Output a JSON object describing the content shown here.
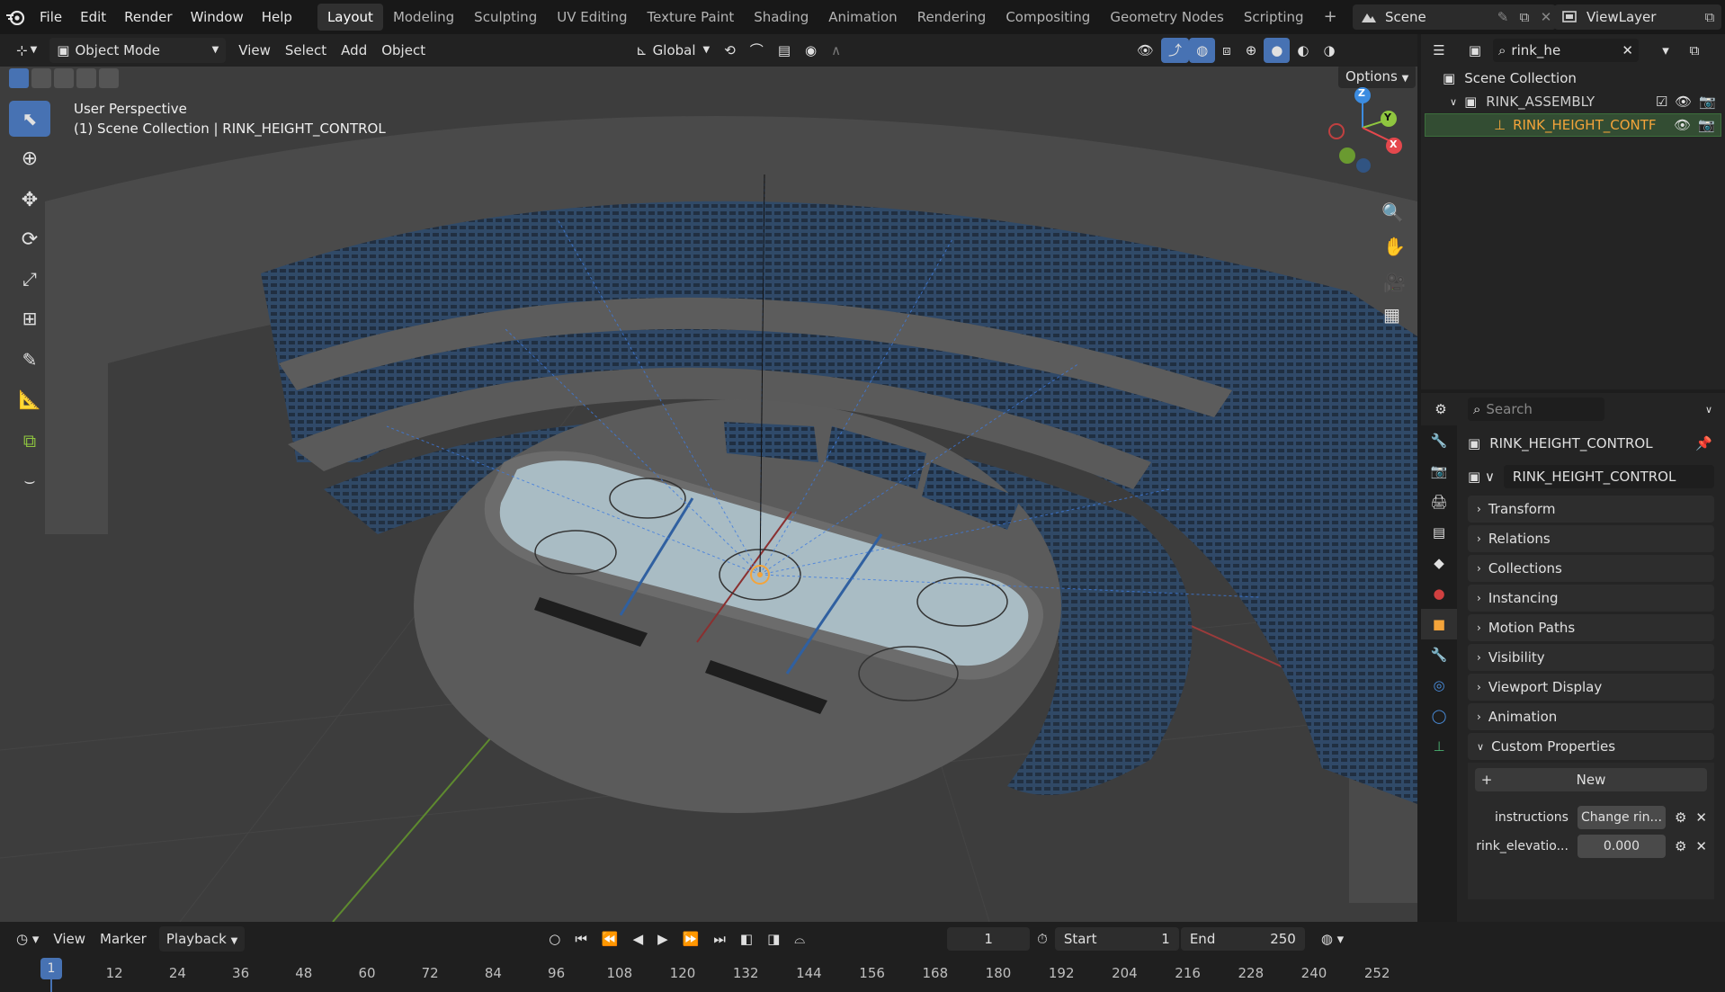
{
  "menu": {
    "items": [
      "File",
      "Edit",
      "Render",
      "Window",
      "Help"
    ]
  },
  "workspaces": {
    "tabs": [
      "Layout",
      "Modeling",
      "Sculpting",
      "UV Editing",
      "Texture Paint",
      "Shading",
      "Animation",
      "Rendering",
      "Compositing",
      "Geometry Nodes",
      "Scripting"
    ],
    "active": "Layout",
    "add": "+"
  },
  "scene": {
    "label": "Scene"
  },
  "viewlayer": {
    "label": "ViewLayer"
  },
  "viewport_header": {
    "mode": "Object Mode",
    "menus": [
      "View",
      "Select",
      "Add",
      "Object"
    ],
    "orientation": "Global",
    "options": "Options"
  },
  "viewport": {
    "perspective": "User Perspective",
    "collection": "(1) Scene Collection | RINK_HEIGHT_CONTROL",
    "gizmo": {
      "x": "X",
      "y": "Y",
      "z": "Z"
    }
  },
  "outliner": {
    "search_value": "rink_he",
    "items": [
      {
        "label": "Scene Collection"
      },
      {
        "label": "RINK_ASSEMBLY"
      },
      {
        "label": "RINK_HEIGHT_CONTF"
      }
    ]
  },
  "properties": {
    "search_placeholder": "Search",
    "object_name": "RINK_HEIGHT_CONTROL",
    "data_name": "RINK_HEIGHT_CONTROL",
    "sections": [
      "Transform",
      "Relations",
      "Collections",
      "Instancing",
      "Motion Paths",
      "Visibility",
      "Viewport Display",
      "Animation"
    ],
    "custom_props_label": "Custom Properties",
    "new_label": "New",
    "props": [
      {
        "key": "instructions",
        "value": "Change rin..."
      },
      {
        "key": "rink_elevatio...",
        "value": "0.000"
      }
    ]
  },
  "timeline": {
    "menus": [
      "View",
      "Marker"
    ],
    "playback": "Playback",
    "current_frame": "1",
    "start_label": "Start",
    "start_value": "1",
    "end_label": "End",
    "end_value": "250",
    "ticks": [
      "1",
      "12",
      "24",
      "36",
      "48",
      "60",
      "72",
      "84",
      "96",
      "108",
      "120",
      "132",
      "144",
      "156",
      "168",
      "180",
      "192",
      "204",
      "216",
      "228",
      "240",
      "252"
    ]
  },
  "colors": {
    "accent": "#4772b3",
    "selected_row": "#334d33",
    "highlight_text": "#f4a43a",
    "x_axis": "#e5484d",
    "y_axis": "#8fc63f",
    "z_axis": "#3c8ce0"
  }
}
